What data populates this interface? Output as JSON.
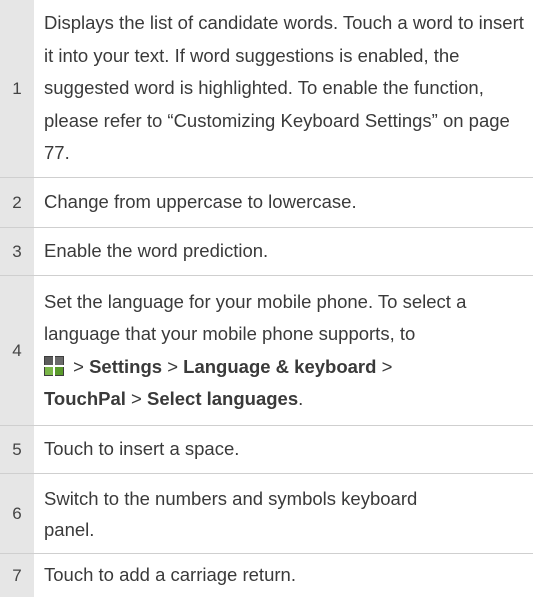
{
  "rows": [
    {
      "number": "1",
      "text": "Displays the list of candidate words. Touch a word to insert it into your text. If word suggestions is enabled, the suggested word is highlighted. To enable the function, please refer to “Customizing Keyboard Settings” on page 77."
    },
    {
      "number": "2",
      "text": "Change from uppercase to lowercase."
    },
    {
      "number": "3",
      "text": "Enable the word prediction."
    },
    {
      "number": "4",
      "text": "Set the language for your mobile phone. To select a language that your mobile phone supports, to",
      "sep1": " > ",
      "settings": "Settings",
      "sep2": " > ",
      "language": "Language & keyboard",
      "sep3": " > ",
      "touchpal": "TouchPal",
      "sep4": " > ",
      "select": "Select languages",
      "end": ".",
      "icon": "menu-key-icon"
    },
    {
      "number": "5",
      "text": "Touch to insert a space."
    },
    {
      "number": "6",
      "text": "Switch to the numbers and symbols keyboard panel."
    },
    {
      "number": "7",
      "text": "Touch to add a carriage return."
    }
  ],
  "colors": {
    "number_column": "#e6e6e6",
    "divider": "#cfcfcf",
    "text": "#3a3a3a",
    "icon_dark": "#3d3d3d",
    "icon_green": "#7ab648"
  }
}
